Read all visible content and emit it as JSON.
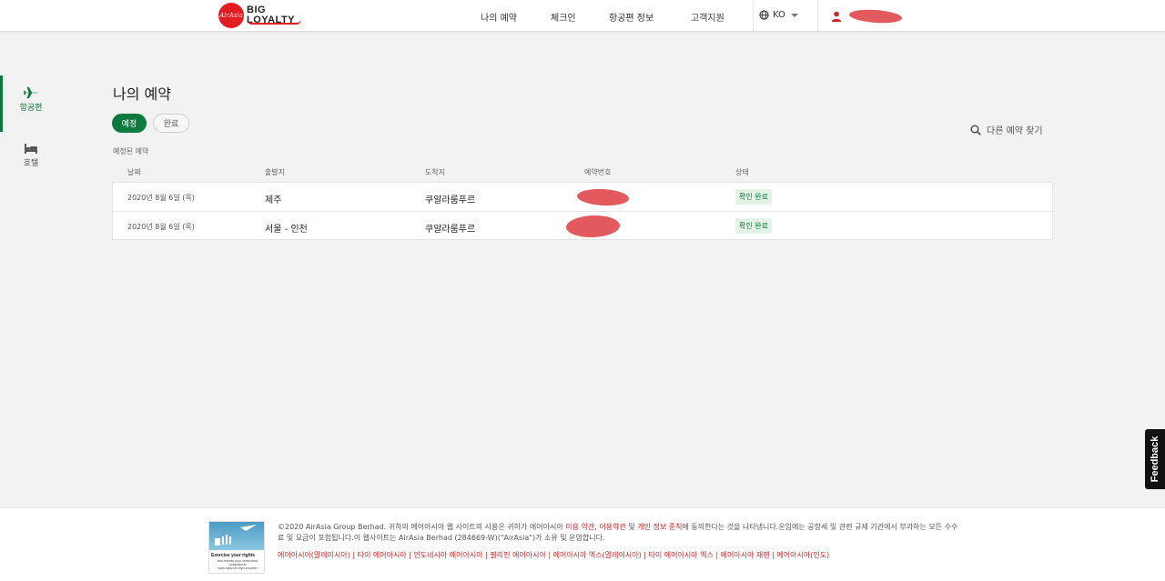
{
  "header": {
    "logo_mark": "AirAsia",
    "logo_line1": "BIG",
    "logo_line2": "LOYALTY",
    "nav": [
      "나의 예약",
      "체크인",
      "항공편 정보",
      "고객지원"
    ],
    "language": "KO"
  },
  "sidebar": {
    "items": [
      {
        "label": "항공편",
        "icon": "plane-icon",
        "active": true
      },
      {
        "label": "호텔",
        "icon": "bed-icon",
        "active": false
      }
    ]
  },
  "main": {
    "title": "나의 예약",
    "tabs": [
      {
        "label": "예정",
        "active": true
      },
      {
        "label": "완료",
        "active": false
      }
    ],
    "find_label": "다른 예약 찾기",
    "section_label": "예정된 예약",
    "columns": [
      "날짜",
      "출발지",
      "도착지",
      "예약번호",
      "상태"
    ],
    "rows": [
      {
        "date": "2020년 8월 6일 (목)",
        "origin": "제주",
        "destination": "쿠알라룸푸르",
        "status": "확인 완료"
      },
      {
        "date": "2020년 8월 6일 (목)",
        "origin": "서울 - 인천",
        "destination": "쿠알라룸푸르",
        "status": "확인 완료"
      }
    ]
  },
  "feedback": "Feedback",
  "footer": {
    "image_title": "Exercise your rights",
    "image_sub": "and redress your unresolved complaint at www.mavcom.my/consumer",
    "copy_a": "©2020 AirAsia Group Berhad. 귀하의 에어아시아 웹 사이트의 사용은 귀하가 에어아시아 ",
    "link_terms": "이용 약관",
    "sep1": ", ",
    "link_use": "이용약관",
    "and": " 및 ",
    "link_privacy": "개인 정보 준칙",
    "copy_b": "에 동의한다는 것을 나타냅니다.운임에는 공항세 및 관련 규제 기관에서 부과하는 모든 수수료 및 요금이 포함됩니다.이 웹사이트는 AirAsia Berhad (284669-W)(\"AirAsia\")가 소유 및 운영합니다.",
    "links": "에어아시아(말레이시아) | 타이 에어아시아 | 인도네시아 에어아시아 | 필리핀 에어아시아 | 에어아시아 엑스(말레이시아) | 타이 에어아시아 엑스 | 에어아시아 재팬 | 에어아시아(인도)"
  },
  "colors": {
    "brand_red": "#e31c23",
    "accent_green": "#0b7a3e",
    "badge_bg": "#e3f3e6"
  }
}
